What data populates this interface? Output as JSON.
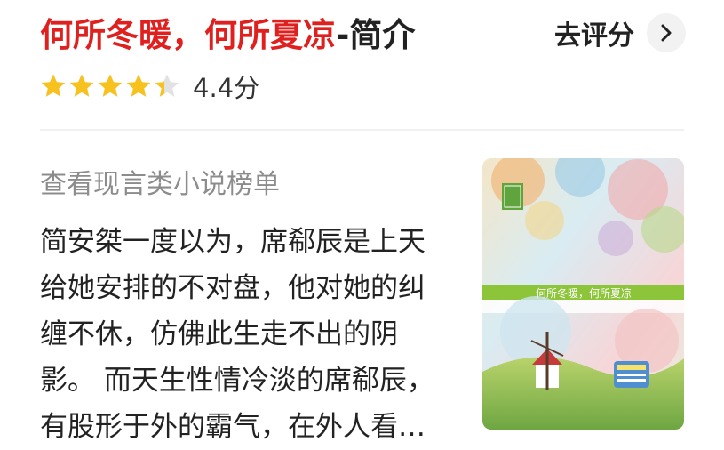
{
  "book": {
    "title_red": "何所冬暖，何所夏凉",
    "title_suffix": "-简介",
    "rating_label": "4.4分",
    "rating_value": 4.4,
    "rating_max": 5,
    "cover_title": "何所冬暖，何所夏凉"
  },
  "actions": {
    "rate_label": "去评分",
    "rank_link": "查看现言类小说榜单"
  },
  "description": "简安桀一度以为，席郗辰是上天给她安排的不对盘，他对她的纠缠不休，仿佛此生走不出的阴影。 而天生性情冷淡的席郗辰，有股形于外的霸气，在外人看…",
  "colors": {
    "title_red": "#e0201e",
    "star_gold": "#f7c21e",
    "star_empty": "#e2e2e2",
    "muted_text": "#8c8c8c"
  },
  "icons": {
    "rate_arrow": "chevron-right-icon",
    "star": "star-icon"
  }
}
